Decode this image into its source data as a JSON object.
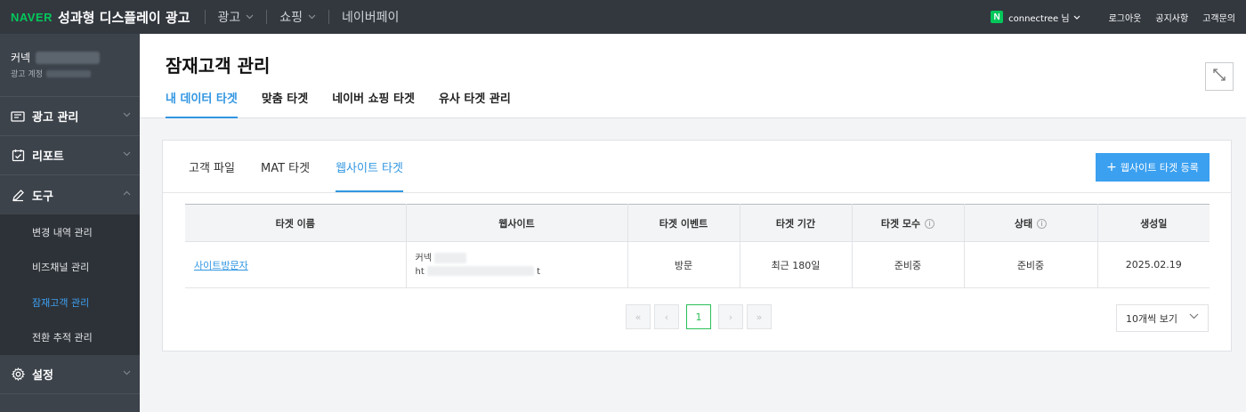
{
  "topbar": {
    "logo": "NAVER",
    "product": "성과형 디스플레이 광고",
    "menu": [
      {
        "label": "광고",
        "has_chevron": true
      },
      {
        "label": "쇼핑",
        "has_chevron": true
      },
      {
        "label": "네이버페이",
        "has_chevron": false
      }
    ],
    "user_badge": "N",
    "user_name": "connectree 님",
    "links": [
      "로그아웃",
      "공지사항",
      "고객문의"
    ]
  },
  "sidebar": {
    "account_name": "커넥",
    "account_sub": "광고 계정",
    "items": [
      {
        "label": "광고 관리",
        "icon": "ad-manage-icon"
      },
      {
        "label": "리포트",
        "icon": "report-icon"
      },
      {
        "label": "도구",
        "icon": "tool-icon"
      }
    ],
    "sub_items": [
      {
        "label": "변경 내역 관리",
        "active": false
      },
      {
        "label": "비즈채널 관리",
        "active": false
      },
      {
        "label": "잠재고객 관리",
        "active": true
      },
      {
        "label": "전환 추적 관리",
        "active": false
      }
    ],
    "settings_label": "설정"
  },
  "header": {
    "title": "잠재고객 관리",
    "tabs": [
      "내 데이터 타겟",
      "맞춤 타겟",
      "네이버 쇼핑 타겟",
      "유사 타겟 관리"
    ],
    "active_tab": 0
  },
  "card": {
    "tabs": [
      "고객 파일",
      "MAT 타겟",
      "웹사이트 타겟"
    ],
    "active_tab": 2,
    "register_button": "웹사이트 타겟 등록",
    "table": {
      "headers": [
        "타겟 이름",
        "웹사이트",
        "타겟 이벤트",
        "타겟 기간",
        "타겟 모수",
        "상태",
        "생성일"
      ],
      "rows": [
        {
          "name": "사이트방문자",
          "site_name": "커넥",
          "site_url": "ht",
          "site_url_end": "t",
          "event": "방문",
          "period": "최근 180일",
          "size": "준비중",
          "status": "준비중",
          "created": "2025.02.19"
        }
      ]
    },
    "pagination": {
      "first": "«",
      "prev": "‹",
      "current": "1",
      "next": "›",
      "last": "»"
    },
    "page_size": "10개씩 보기"
  },
  "colors": {
    "accent": "#3196e2",
    "naver_green": "#03c75a",
    "sidebar": "#3c434b",
    "topbar": "#33383f"
  }
}
